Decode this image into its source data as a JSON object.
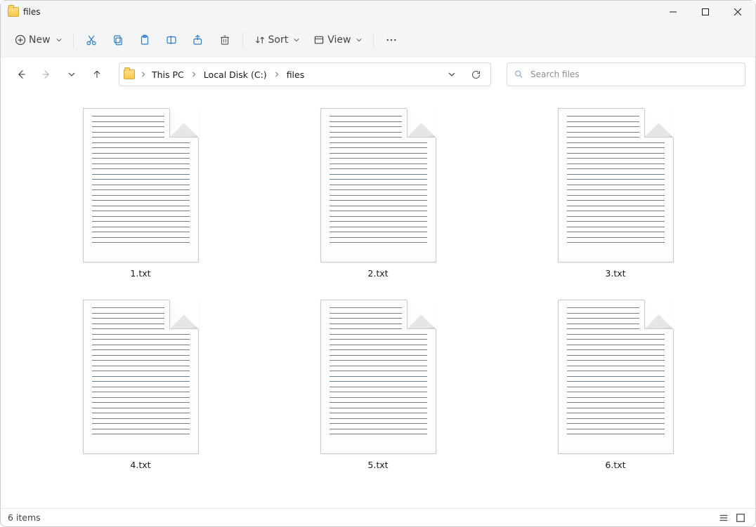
{
  "window": {
    "title": "files"
  },
  "toolbar": {
    "new_label": "New",
    "sort_label": "Sort",
    "view_label": "View"
  },
  "breadcrumbs": [
    "This PC",
    "Local Disk (C:)",
    "files"
  ],
  "search": {
    "placeholder": "Search files"
  },
  "files": [
    {
      "name": "1.txt"
    },
    {
      "name": "2.txt"
    },
    {
      "name": "3.txt"
    },
    {
      "name": "4.txt"
    },
    {
      "name": "5.txt"
    },
    {
      "name": "6.txt"
    }
  ],
  "status": {
    "count_text": "6 items"
  }
}
